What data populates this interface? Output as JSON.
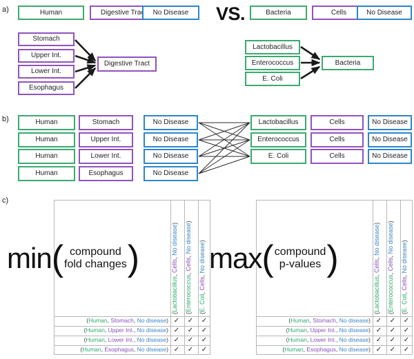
{
  "colors": {
    "green": "#3aa96f",
    "purple": "#9052bd",
    "blue": "#2e84c8",
    "text_green": "#2bab6d",
    "text_purple": "#8a4fbd",
    "text_blue": "#3a86c8",
    "edge": "#1a1a1a",
    "grid": "#b7b7b7"
  },
  "panels": {
    "a_label": "a)",
    "b_label": "b)",
    "c_label": "c)"
  },
  "panel_a": {
    "vs_label": "VS.",
    "left_triple": [
      {
        "label": "Human",
        "color": "green"
      },
      {
        "label": "Digestive Tract",
        "color": "purple"
      },
      {
        "label": "No Disease",
        "color": "blue"
      }
    ],
    "right_triple": [
      {
        "label": "Bacteria",
        "color": "green"
      },
      {
        "label": "Cells",
        "color": "purple"
      },
      {
        "label": "No Disease",
        "color": "blue"
      }
    ],
    "left_hierarchy": {
      "children": [
        "Stomach",
        "Upper Int.",
        "Lower Int.",
        "Esophagus"
      ],
      "parent": "Digestive Tract",
      "color": "purple"
    },
    "right_hierarchy": {
      "children": [
        "Lactobacillus",
        "Enterococcus",
        "E. Coli"
      ],
      "parent": "Bacteria",
      "color": "green"
    }
  },
  "panel_b": {
    "left_rows": [
      {
        "organism": "Human",
        "tissue": "Stomach",
        "disease": "No Disease"
      },
      {
        "organism": "Human",
        "tissue": "Upper Int.",
        "disease": "No Disease"
      },
      {
        "organism": "Human",
        "tissue": "Lower Int.",
        "disease": "No Disease"
      },
      {
        "organism": "Human",
        "tissue": "Esophagus",
        "disease": "No Disease"
      }
    ],
    "right_rows": [
      {
        "organism": "Lactobacillus",
        "tissue": "Cells",
        "disease": "No Disease"
      },
      {
        "organism": "Enterococcus",
        "tissue": "Cells",
        "disease": "No Disease"
      },
      {
        "organism": "E. Coli",
        "tissue": "Cells",
        "disease": "No Disease"
      }
    ]
  },
  "panel_c": {
    "left_table": {
      "function": "min",
      "operand_line1": "compound",
      "operand_line2": "fold changes",
      "open_paren": "(",
      "close_paren": ")",
      "column_headers": [
        {
          "open": "(",
          "organism": "Lactobacillus",
          "tissue": "Cells",
          "disease": "No disease",
          "close": ")"
        },
        {
          "open": "(",
          "organism": "Enterococcus",
          "tissue": "Cells",
          "disease": "No disease",
          "close": ")"
        },
        {
          "open": "(",
          "organism": "E. Coli",
          "tissue": "Cells",
          "disease": "No disease",
          "close": ")"
        }
      ],
      "row_headers": [
        {
          "open": "(",
          "organism": "Human",
          "tissue": "Stomach",
          "disease": "No disease",
          "close": ")"
        },
        {
          "open": "(",
          "organism": "Human",
          "tissue": "Upper Int.",
          "disease": "No disease",
          "close": ")"
        },
        {
          "open": "(",
          "organism": "Human",
          "tissue": "Lower Int.",
          "disease": "No disease",
          "close": ")"
        },
        {
          "open": "(",
          "organism": "Human",
          "tissue": "Esophagus",
          "disease": "No disease",
          "close": ")"
        }
      ],
      "cells": [
        [
          "✓",
          "✓",
          "✓"
        ],
        [
          "✓",
          "✓",
          "✓"
        ],
        [
          "✓",
          "✓",
          "✓"
        ],
        [
          "✓",
          "✓",
          "✓"
        ]
      ]
    },
    "right_table": {
      "function": "max",
      "operand_line1": "compound",
      "operand_line2": "p-values",
      "open_paren": "(",
      "close_paren": ")",
      "column_headers": [
        {
          "open": "(",
          "organism": "Lactobacillus",
          "tissue": "Cells",
          "disease": "No disease",
          "close": ")"
        },
        {
          "open": "(",
          "organism": "Enterococcus",
          "tissue": "Cells",
          "disease": "No disease",
          "close": ")"
        },
        {
          "open": "(",
          "organism": "E. Coli",
          "tissue": "Cells",
          "disease": "No disease",
          "close": ")"
        }
      ],
      "row_headers": [
        {
          "open": "(",
          "organism": "Human",
          "tissue": "Stomach",
          "disease": "No disease",
          "close": ")"
        },
        {
          "open": "(",
          "organism": "Human",
          "tissue": "Upper Int.",
          "disease": "No disease",
          "close": ")"
        },
        {
          "open": "(",
          "organism": "Human",
          "tissue": "Lower Int.",
          "disease": "No disease",
          "close": ")"
        },
        {
          "open": "(",
          "organism": "Human",
          "tissue": "Esophagus",
          "disease": "No disease",
          "close": ")"
        }
      ],
      "cells": [
        [
          "✓",
          "✓",
          "✓"
        ],
        [
          "✓",
          "✓",
          "✓"
        ],
        [
          "✓",
          "✓",
          "✓"
        ],
        [
          "✓",
          "✓",
          "✓"
        ]
      ]
    }
  }
}
